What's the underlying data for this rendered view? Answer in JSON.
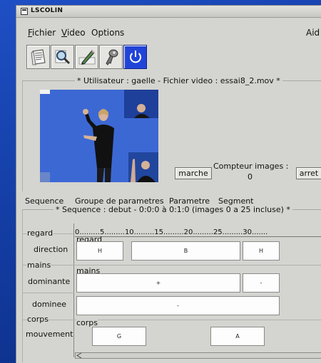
{
  "window": {
    "title": "LSCOLIN"
  },
  "menu": {
    "fichier": {
      "underline": "F",
      "rest": "ichier"
    },
    "video": {
      "underline": "V",
      "rest": "ideo"
    },
    "options": "Options",
    "aide": "Aid"
  },
  "toolbar": {
    "buttons": [
      {
        "icon": "document-icon"
      },
      {
        "icon": "magnifier-icon"
      },
      {
        "icon": "pencil-icon"
      },
      {
        "icon": "key-icon"
      },
      {
        "icon": "power-icon"
      }
    ]
  },
  "video_panel": {
    "caption": "* Utilisateur : gaelle  -  Fichier video : essai8_2.mov *",
    "counter_label": "Compteur images :",
    "counter_value": "0",
    "play_label": "marche",
    "stop_label": "arret"
  },
  "tabs": [
    "Sequence",
    "Groupe de parametres",
    "Parametre",
    "Segment"
  ],
  "sequence": {
    "caption": "*  Sequence : debut  -  0:0:0 à 0:1:0  (images 0 a 25 incluse)  *",
    "ruler": "0.........5.........10.........15.........20.........25.........30......."
  },
  "tracks": {
    "regard": {
      "group_label": "regard",
      "inner_label": "regard",
      "row_label": "direction",
      "segments": [
        "H",
        "B",
        "H"
      ]
    },
    "mains": {
      "group_label": "mains",
      "inner_label": "mains",
      "rows": [
        {
          "label": "dominante",
          "segments": [
            "+",
            "-"
          ]
        },
        {
          "label": "dominee",
          "segments": [
            "-"
          ]
        }
      ]
    },
    "corps": {
      "group_label": "corps",
      "inner_label": "corps",
      "row_label": "mouvement",
      "segments": [
        "G",
        "A"
      ]
    }
  },
  "colors": {
    "desktop": "#1e4fc4",
    "window_bg": "#d4d4d0",
    "video_bg": "#3d6ad6",
    "power_button": "#1f3fd6"
  }
}
